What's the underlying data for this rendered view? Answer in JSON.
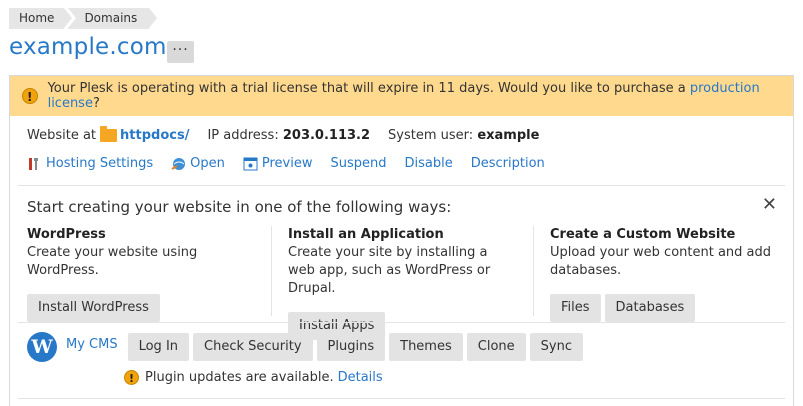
{
  "breadcrumb": {
    "items": [
      "Home",
      "Domains"
    ]
  },
  "page": {
    "title": "example.com",
    "more_label": "···"
  },
  "warning": {
    "text": "Your Plesk is operating with a trial license that will expire in 11 days. Would you like to purchase a",
    "link": "production license",
    "suffix": "?"
  },
  "info": {
    "website_label": "Website at",
    "docroot": "httpdocs/",
    "ip_label": "IP address:",
    "ip_value": "203.0.113.2",
    "user_label": "System user:",
    "user_value": "example"
  },
  "actions": {
    "hosting": "Hosting Settings",
    "open": "Open",
    "preview": "Preview",
    "suspend": "Suspend",
    "disable": "Disable",
    "description": "Description"
  },
  "start": {
    "title": "Start creating your website in one of the following ways:",
    "close": "✕",
    "wordpress": {
      "heading": "WordPress",
      "text": "Create your website using WordPress.",
      "button": "Install WordPress"
    },
    "app": {
      "heading": "Install an Application",
      "text": "Create your site by installing a web app, such as WordPress or Drupal.",
      "button": "Install Apps"
    },
    "custom": {
      "heading": "Create a Custom Website",
      "text": "Upload your web content and add databases.",
      "files": "Files",
      "databases": "Databases"
    }
  },
  "cms": {
    "logo": "W",
    "name": "My CMS",
    "buttons": {
      "login": "Log In",
      "security": "Check Security",
      "plugins": "Plugins",
      "themes": "Themes",
      "clone": "Clone",
      "sync": "Sync"
    },
    "notice": "Plugin updates are available.",
    "details": "Details"
  },
  "colors": {
    "accent": "#2878c8",
    "warning_bg": "#ffd98e",
    "button_bg": "#e3e3e3"
  }
}
